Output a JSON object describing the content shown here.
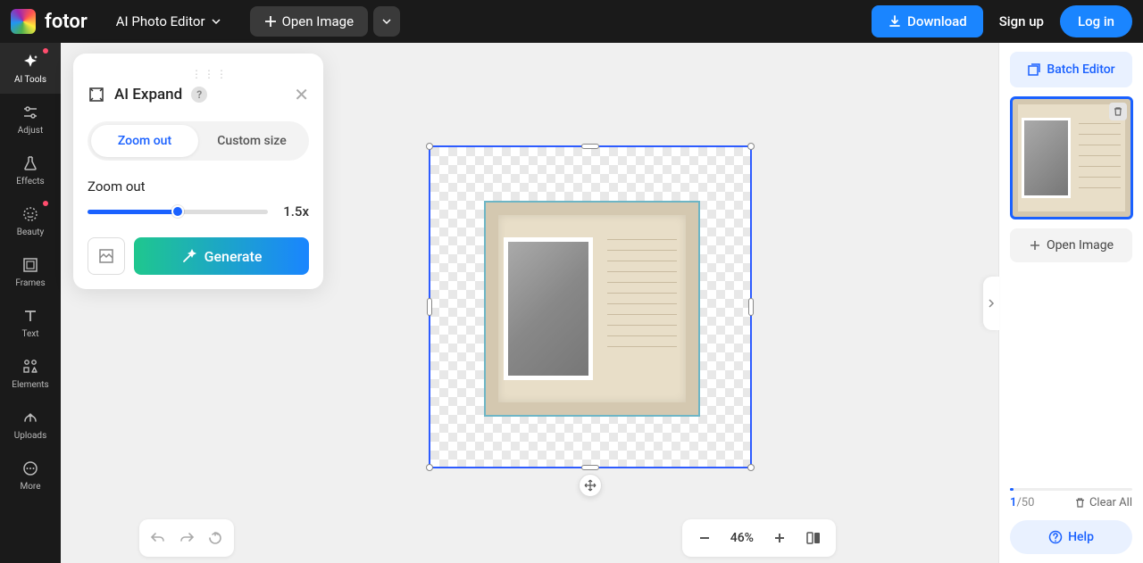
{
  "brand": "fotor",
  "topbar": {
    "editor_mode": "AI Photo Editor",
    "open_image": "Open Image",
    "download": "Download",
    "signup": "Sign up",
    "login": "Log in"
  },
  "sidebar": {
    "items": [
      {
        "label": "AI Tools"
      },
      {
        "label": "Adjust"
      },
      {
        "label": "Effects"
      },
      {
        "label": "Beauty"
      },
      {
        "label": "Frames"
      },
      {
        "label": "Text"
      },
      {
        "label": "Elements"
      },
      {
        "label": "Uploads"
      },
      {
        "label": "More"
      }
    ]
  },
  "panel": {
    "title": "AI Expand",
    "tabs": {
      "zoom_out": "Zoom out",
      "custom": "Custom size"
    },
    "slider_label": "Zoom out",
    "slider_value": "1.5x",
    "generate": "Generate"
  },
  "right": {
    "batch": "Batch Editor",
    "open_image": "Open Image",
    "current": "1",
    "total": "/50",
    "clear": "Clear All",
    "help": "Help"
  },
  "zoom": "46%"
}
